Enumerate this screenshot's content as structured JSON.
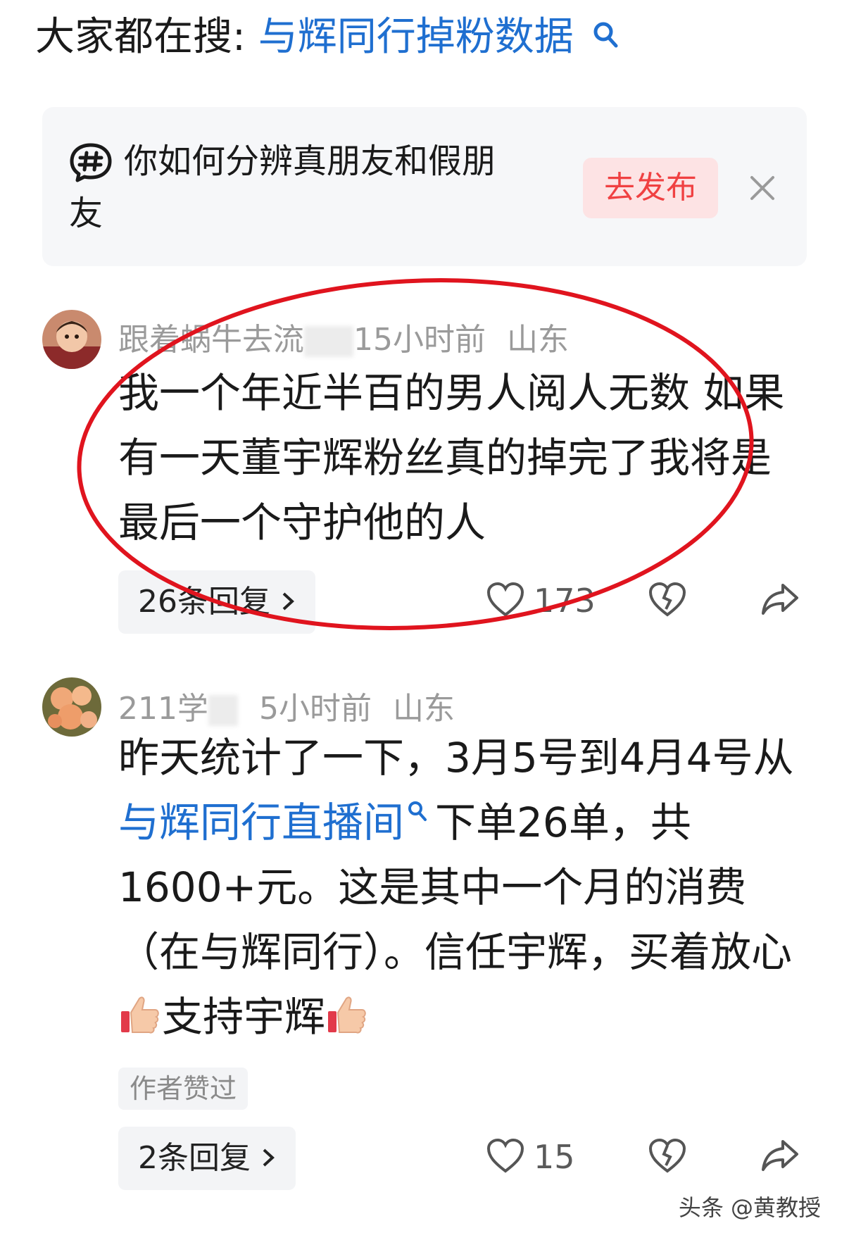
{
  "search_suggestion": {
    "prefix": "大家都在搜:",
    "term": "与辉同行掉粉数据",
    "icon": "search-icon"
  },
  "topic_card": {
    "icon": "hashtag-bubble-icon",
    "text": "你如何分辨真朋友和假朋友",
    "publish_label": "去发布",
    "close_icon": "close-icon"
  },
  "comments": [
    {
      "username": "跟着蜗牛去流",
      "time": "15小时前",
      "location": "山东",
      "text": "我一个年近半百的男人阅人无数 如果有一天董宇辉粉丝真的掉完了我将是最后一个守护他的人",
      "replies_label": "26条回复",
      "like_count": "173"
    },
    {
      "username": "211学",
      "time": "5小时前",
      "location": "山东",
      "text_parts": {
        "before_link": "昨天统计了一下，3月5号到4月4号从",
        "link": "与辉同行直播间",
        "after_link": "下单26单，共1600+元。这是其中一个月的消费（在与辉同行）。信任宇辉，买着放心",
        "support": "支持宇辉"
      },
      "author_liked": "作者赞过",
      "replies_label": "2条回复",
      "like_count": "15"
    }
  ],
  "watermark": "头条 @黄教授",
  "colors": {
    "link": "#1f6fd0",
    "publish_text": "#f04142",
    "publish_bg": "#fde3e4",
    "annotation_red": "#e0141e"
  }
}
